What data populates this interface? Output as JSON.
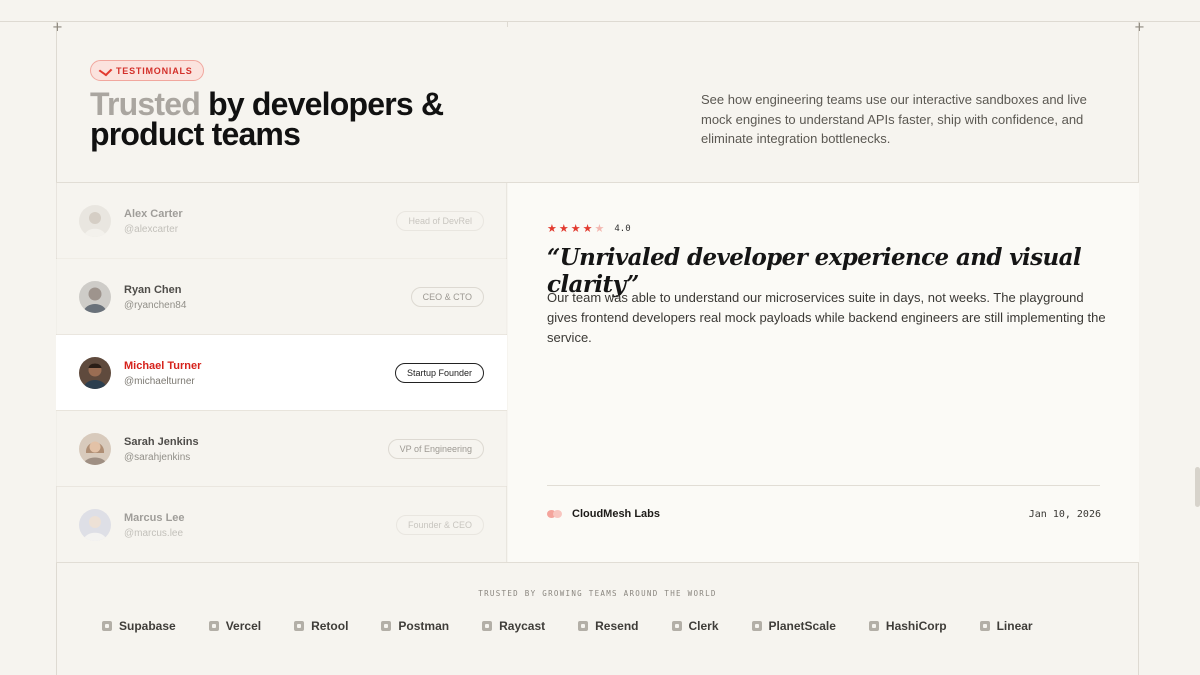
{
  "header": {
    "badge": "TESTIMONIALS",
    "headline_muted": "Trusted",
    "headline_rest": " by developers & product teams",
    "intro": "See how engineering teams use our interactive sandboxes and live mock engines to understand APIs faster, ship with confidence, and eliminate integration bottlenecks."
  },
  "testimonials": [
    {
      "name": "Alex Carter",
      "handle": "@alexcarter",
      "role": "Head of DevRel"
    },
    {
      "name": "Ryan Chen",
      "handle": "@ryanchen84",
      "role": "CEO & CTO"
    },
    {
      "name": "Michael Turner",
      "handle": "@michaelturner",
      "role": "Startup Founder"
    },
    {
      "name": "Sarah Jenkins",
      "handle": "@sarahjenkins",
      "role": "VP of Engineering"
    },
    {
      "name": "Marcus Lee",
      "handle": "@marcus.lee",
      "role": "Founder & CEO"
    }
  ],
  "active_index": 2,
  "detail": {
    "rating": "4.0",
    "stars_filled": 4,
    "stars_total": 5,
    "quote": "“Unrivaled developer experience and visual clarity”",
    "body": "Our team was able to understand our microservices suite in days, not weeks. The playground gives frontend developers real mock payloads while backend engineers are still implementing the service.",
    "company": "CloudMesh Labs",
    "date": "Jan 10, 2026"
  },
  "trusted": {
    "label": "TRUSTED BY GROWING TEAMS AROUND THE WORLD",
    "logos": [
      "Supabase",
      "Vercel",
      "Retool",
      "Postman",
      "Raycast",
      "Resend",
      "Clerk",
      "PlanetScale",
      "HashiCorp",
      "Linear"
    ]
  },
  "colors": {
    "accent": "#e23a2f",
    "background": "#f6f4ef"
  }
}
